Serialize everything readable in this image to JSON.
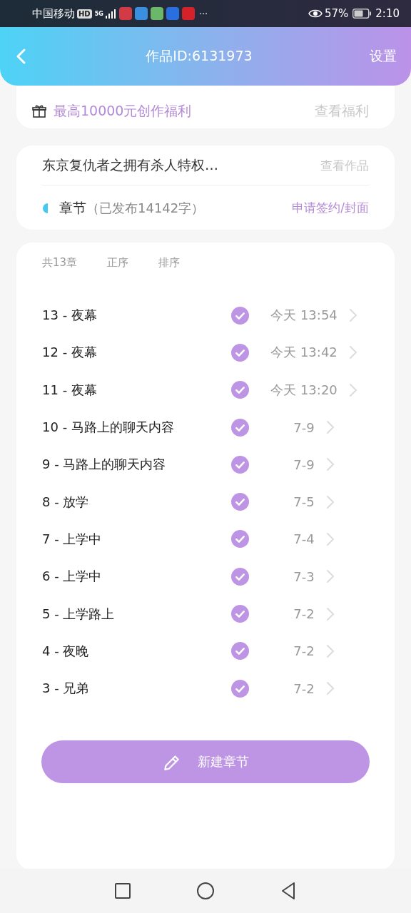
{
  "status_bar": {
    "carrier": "中国移动",
    "hd": "HD",
    "network": "5G",
    "more": "···",
    "battery_percent": "57%",
    "time": "2:10"
  },
  "header": {
    "title": "作品ID:6131973",
    "action": "设置"
  },
  "bonus": {
    "text": "最高10000元创作福利",
    "link": "查看福利"
  },
  "work": {
    "title": "东京复仇者之拥有杀人特权…",
    "link": "查看作品",
    "section": "章节",
    "count": "（已发布14142字）",
    "apply": "申请签约/封面"
  },
  "chapters": {
    "total": "共13章",
    "order": "正序",
    "sort": "排序",
    "items": [
      {
        "title": "13 - 夜幕",
        "published": true,
        "date": "今天 13:54"
      },
      {
        "title": "12 - 夜幕",
        "published": true,
        "date": "今天 13:42"
      },
      {
        "title": "11 - 夜幕",
        "published": true,
        "date": "今天 13:20"
      },
      {
        "title": "10 - 马路上的聊天内容",
        "published": true,
        "date": "7-9"
      },
      {
        "title": "9 - 马路上的聊天内容",
        "published": true,
        "date": "7-9"
      },
      {
        "title": "8 - 放学",
        "published": true,
        "date": "7-5"
      },
      {
        "title": "7 - 上学中",
        "published": true,
        "date": "7-4"
      },
      {
        "title": "6 - 上学中",
        "published": true,
        "date": "7-3"
      },
      {
        "title": "5 - 上学路上",
        "published": true,
        "date": "7-2"
      },
      {
        "title": "4 - 夜晚",
        "published": true,
        "date": "7-2"
      },
      {
        "title": "3 - 兄弟",
        "published": true,
        "date": "7-2"
      }
    ]
  },
  "new_button": "新建章节"
}
